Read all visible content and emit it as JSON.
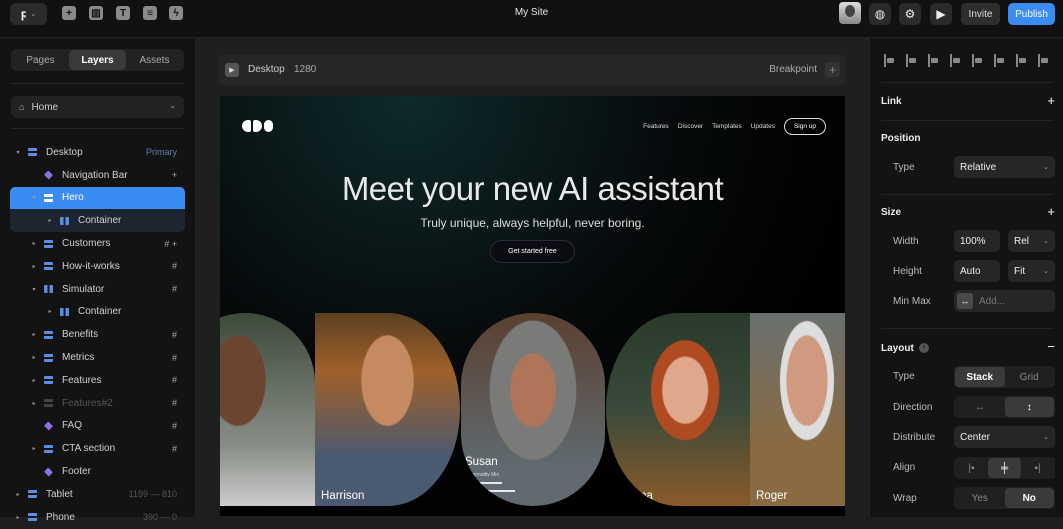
{
  "topbar": {
    "site_title": "My Site",
    "tools": [
      "insert-icon",
      "layout-icon",
      "text-icon",
      "cms-icon",
      "interactions-icon"
    ],
    "invite_label": "Invite",
    "publish_label": "Publish",
    "accent_color": "#3b8cf2"
  },
  "left_panel": {
    "tabs": [
      {
        "label": "Pages",
        "active": false
      },
      {
        "label": "Layers",
        "active": true
      },
      {
        "label": "Assets",
        "active": false
      }
    ],
    "page_select": "Home",
    "layers": [
      {
        "label": "Desktop",
        "icon": "stack",
        "depth": 0,
        "toggle": "open",
        "right": "Primary"
      },
      {
        "label": "Navigation Bar",
        "icon": "component",
        "depth": 1,
        "toggle": "",
        "right": "+"
      },
      {
        "label": "Hero",
        "icon": "stack",
        "depth": 1,
        "toggle": "open",
        "right": "",
        "selected": true
      },
      {
        "label": "Container",
        "icon": "column",
        "depth": 2,
        "toggle": "closed",
        "right": ""
      },
      {
        "label": "Customers",
        "icon": "stack",
        "depth": 1,
        "toggle": "closed",
        "right": "# +"
      },
      {
        "label": "How-it-works",
        "icon": "stack",
        "depth": 1,
        "toggle": "closed",
        "right": "#"
      },
      {
        "label": "Simulator",
        "icon": "column",
        "depth": 1,
        "toggle": "open",
        "right": "#"
      },
      {
        "label": "Container",
        "icon": "column",
        "depth": 2,
        "toggle": "closed",
        "right": ""
      },
      {
        "label": "Benefits",
        "icon": "stack",
        "depth": 1,
        "toggle": "closed",
        "right": "#"
      },
      {
        "label": "Metrics",
        "icon": "stack",
        "depth": 1,
        "toggle": "closed",
        "right": "#"
      },
      {
        "label": "Features",
        "icon": "stack",
        "depth": 1,
        "toggle": "closed",
        "right": "#"
      },
      {
        "label": "Features#2",
        "icon": "stack",
        "depth": 1,
        "toggle": "closed",
        "right": "#",
        "dim": true
      },
      {
        "label": "FAQ",
        "icon": "component",
        "depth": 1,
        "toggle": "",
        "right": "#"
      },
      {
        "label": "CTA section",
        "icon": "stack",
        "depth": 1,
        "toggle": "closed",
        "right": "#"
      },
      {
        "label": "Footer",
        "icon": "component",
        "depth": 1,
        "toggle": "",
        "right": ""
      },
      {
        "label": "Tablet",
        "icon": "stack",
        "depth": 0,
        "toggle": "closed",
        "right": "1199 — 810"
      },
      {
        "label": "Phone",
        "icon": "stack",
        "depth": 0,
        "toggle": "closed",
        "right": "390 — 0"
      }
    ]
  },
  "canvas": {
    "breakpoint_name": "Desktop",
    "breakpoint_width": "1280",
    "breakpoint_label": "Breakpoint",
    "site": {
      "nav_links": [
        "Features",
        "Discover",
        "Templates",
        "Updates"
      ],
      "signup_label": "Sign up",
      "hero_title": "Meet your new AI assistant",
      "hero_subtitle": "Truly unique, always helpful, never boring.",
      "cta_label": "Get started free",
      "people": [
        {
          "name": ""
        },
        {
          "name": "Harrison"
        },
        {
          "name": "Susan",
          "caption": "Personality Mix",
          "mix": [
            0.68,
            0.9,
            0.22
          ]
        },
        {
          "name": "Gemma"
        },
        {
          "name": "Roger"
        }
      ]
    }
  },
  "right_panel": {
    "align_icons": [
      "align-left-icon",
      "align-center-h-icon",
      "align-right-icon",
      "align-top-icon",
      "align-center-v-icon",
      "align-bottom-icon",
      "distribute-h-icon",
      "distribute-v-icon"
    ],
    "link": {
      "title": "Link"
    },
    "position": {
      "title": "Position",
      "type_label": "Type",
      "type_value": "Relative"
    },
    "size": {
      "title": "Size",
      "width_label": "Width",
      "width_value": "100%",
      "width_unit": "Rel",
      "height_label": "Height",
      "height_value": "Auto",
      "height_unit": "Fit",
      "minmax_label": "Min Max",
      "minmax_placeholder": "Add..."
    },
    "layout": {
      "title": "Layout",
      "type_label": "Type",
      "type_options": [
        "Stack",
        "Grid"
      ],
      "type_selected": "Stack",
      "direction_label": "Direction",
      "direction_selected": "vertical",
      "distribute_label": "Distribute",
      "distribute_value": "Center",
      "align_label": "Align",
      "align_selected": "center",
      "wrap_label": "Wrap",
      "wrap_options": [
        "Yes",
        "No"
      ],
      "wrap_selected": "No"
    }
  }
}
